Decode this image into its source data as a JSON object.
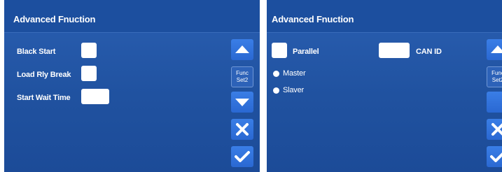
{
  "left_panel": {
    "title": "Advanced Fnuction",
    "fields": [
      {
        "label": "Black Start"
      },
      {
        "label": "Load Rly Break"
      },
      {
        "label": "Start Wait Time"
      }
    ],
    "buttons": {
      "func_line1": "Func",
      "func_line2": "Set2"
    }
  },
  "right_panel": {
    "title": "Advanced Fnuction",
    "parallel_label": "Parallel",
    "can_id_label": "CAN ID",
    "options": [
      {
        "label": "Master"
      },
      {
        "label": "Slaver"
      }
    ],
    "buttons": {
      "func_line1": "Func",
      "func_line2": "Set2"
    }
  },
  "icons": {
    "up": "arrow-up-icon",
    "down": "arrow-down-icon",
    "close": "close-icon",
    "confirm": "checkmark-icon"
  },
  "colors": {
    "background": "#2052a0",
    "button": "#2f72dc",
    "text": "#ffffff"
  }
}
